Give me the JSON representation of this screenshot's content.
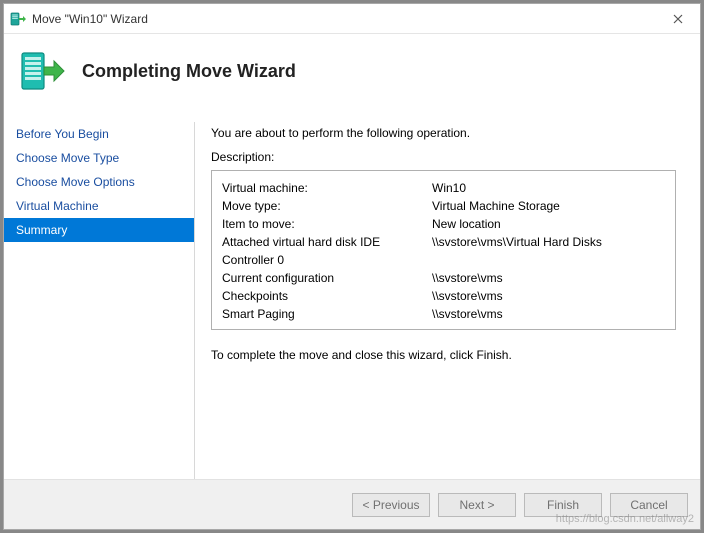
{
  "window": {
    "title": "Move \"Win10\" Wizard",
    "close_tooltip": "Close"
  },
  "header": {
    "title": "Completing Move Wizard"
  },
  "sidebar": {
    "items": [
      {
        "label": "Before You Begin",
        "active": false
      },
      {
        "label": "Choose Move Type",
        "active": false
      },
      {
        "label": "Choose Move Options",
        "active": false
      },
      {
        "label": "Virtual Machine",
        "active": false
      },
      {
        "label": "Summary",
        "active": true
      }
    ]
  },
  "content": {
    "intro": "You are about to perform the following operation.",
    "desc_label": "Description:",
    "rows": [
      {
        "key": "Virtual machine:",
        "value": "Win10"
      },
      {
        "key": "Move type:",
        "value": "Virtual Machine Storage"
      },
      {
        "key": "Item to move:",
        "value": "New location"
      },
      {
        "key": "Attached virtual hard disk  IDE Controller 0",
        "value": "\\\\svstore\\vms\\Virtual Hard Disks"
      },
      {
        "key": "Current configuration",
        "value": "\\\\svstore\\vms"
      },
      {
        "key": "Checkpoints",
        "value": "\\\\svstore\\vms"
      },
      {
        "key": "Smart Paging",
        "value": "\\\\svstore\\vms"
      }
    ],
    "instruction": "To complete the move and close this wizard, click Finish."
  },
  "footer": {
    "previous": "< Previous",
    "next": "Next >",
    "finish": "Finish",
    "cancel": "Cancel"
  },
  "watermark": "https://blog.csdn.net/allway2"
}
